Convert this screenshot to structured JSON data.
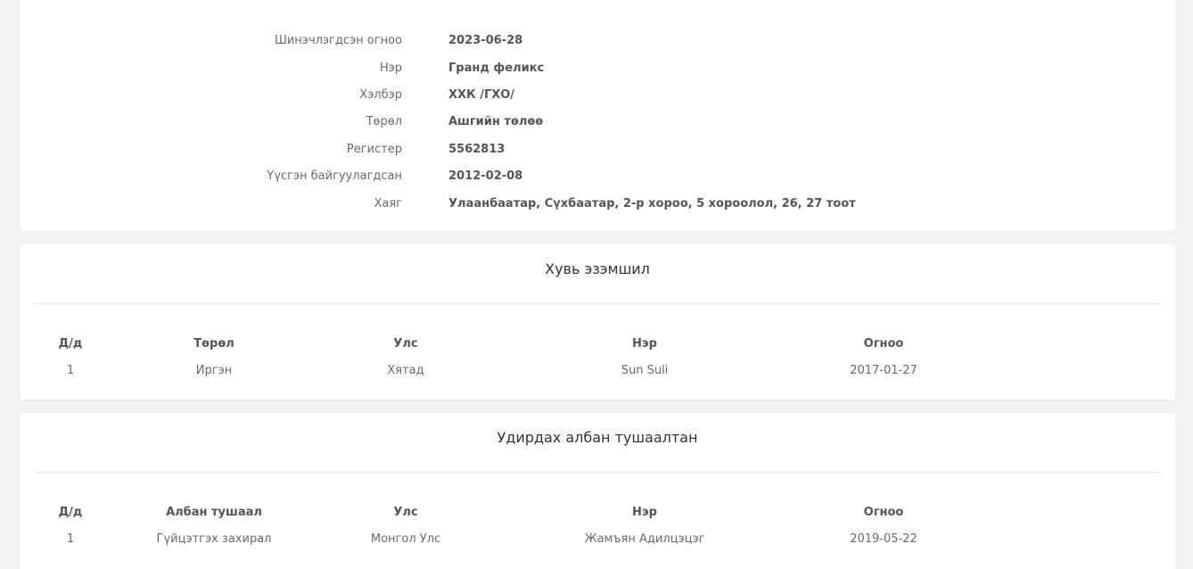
{
  "info": {
    "rows": [
      {
        "label": "Шинэчлэгдсэн огноо",
        "value": "2023-06-28"
      },
      {
        "label": "Нэр",
        "value": "Гранд феликс"
      },
      {
        "label": "Хэлбэр",
        "value": "ХХК /ГХО/"
      },
      {
        "label": "Төрөл",
        "value": "Ашгийн төлөө"
      },
      {
        "label": "Регистер",
        "value": "5562813"
      },
      {
        "label": "Үүсгэн байгуулагдсан",
        "value": "2012-02-08"
      },
      {
        "label": "Хаяг",
        "value": "Улаанбаатар, Сүхбаатар, 2-р хороо, 5 хороолол, 26, 27 тоот"
      }
    ]
  },
  "ownership": {
    "title": "Хувь эзэмшил",
    "headers": [
      "Д/д",
      "Төрөл",
      "Улс",
      "Нэр",
      "Огноо"
    ],
    "rows": [
      [
        "1",
        "Иргэн",
        "Хятад",
        "Sun Suli",
        "2017-01-27"
      ]
    ]
  },
  "management": {
    "title": "Удирдах албан тушаалтан",
    "headers": [
      "Д/д",
      "Албан тушаал",
      "Улс",
      "Нэр",
      "Огноо"
    ],
    "rows": [
      [
        "1",
        "Гүйцэтгэх захирал",
        "Монгол Улс",
        "Жамъян Адилцэцэг",
        "2019-05-22"
      ]
    ]
  }
}
